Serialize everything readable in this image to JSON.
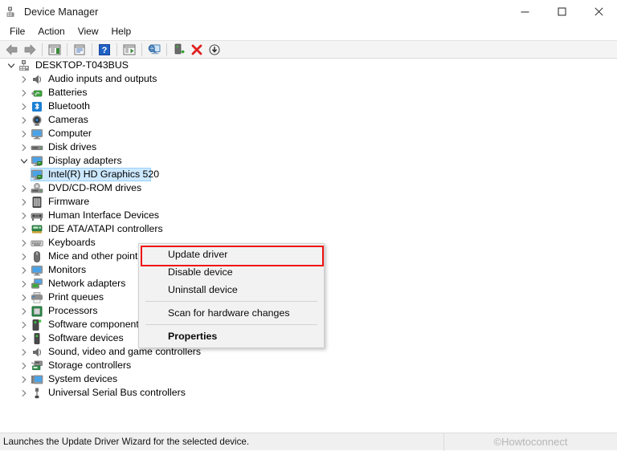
{
  "window": {
    "title": "Device Manager",
    "icon": "device-manager-icon",
    "controls": {
      "minimize": "minimize-icon",
      "maximize": "maximize-icon",
      "close": "close-icon"
    }
  },
  "menubar": {
    "items": [
      {
        "label": "File"
      },
      {
        "label": "Action"
      },
      {
        "label": "View"
      },
      {
        "label": "Help"
      }
    ]
  },
  "toolbar": {
    "buttons": [
      {
        "name": "back-icon",
        "type": "arrow-left"
      },
      {
        "name": "forward-icon",
        "type": "arrow-right"
      },
      {
        "name": "separator-1",
        "type": "separator"
      },
      {
        "name": "show-hide-console-tree-icon",
        "type": "window-tree"
      },
      {
        "name": "separator-2",
        "type": "separator"
      },
      {
        "name": "properties-icon",
        "type": "window-props"
      },
      {
        "name": "separator-3",
        "type": "separator"
      },
      {
        "name": "help-icon",
        "type": "help"
      },
      {
        "name": "separator-4",
        "type": "separator"
      },
      {
        "name": "action-icon",
        "type": "window-play"
      },
      {
        "name": "separator-5",
        "type": "separator"
      },
      {
        "name": "scan-for-hardware-changes-icon",
        "type": "monitor-scan"
      },
      {
        "name": "separator-6",
        "type": "separator"
      },
      {
        "name": "update-driver-icon",
        "type": "device-update"
      },
      {
        "name": "uninstall-device-icon",
        "type": "red-x"
      },
      {
        "name": "disable-device-icon",
        "type": "down-arrow-circle"
      }
    ]
  },
  "tree": {
    "root": {
      "label": "DESKTOP-T043BUS",
      "icon": "computer-root-icon",
      "expanded": true,
      "level": 0
    },
    "items": [
      {
        "label": "Audio inputs and outputs",
        "icon": "speaker-icon",
        "expanded": false,
        "level": 1
      },
      {
        "label": "Batteries",
        "icon": "battery-icon",
        "expanded": false,
        "level": 1
      },
      {
        "label": "Bluetooth",
        "icon": "bluetooth-icon",
        "expanded": false,
        "level": 1
      },
      {
        "label": "Cameras",
        "icon": "camera-icon",
        "expanded": false,
        "level": 1
      },
      {
        "label": "Computer",
        "icon": "monitor-icon",
        "expanded": false,
        "level": 1
      },
      {
        "label": "Disk drives",
        "icon": "disk-drive-icon",
        "expanded": false,
        "level": 1
      },
      {
        "label": "Display adapters",
        "icon": "display-adapter-icon",
        "expanded": true,
        "level": 1
      },
      {
        "label": "Intel(R) HD Graphics 520",
        "icon": "display-adapter-icon",
        "expanded": null,
        "level": 2,
        "selected": true
      },
      {
        "label": "DVD/CD-ROM drives",
        "icon": "optical-drive-icon",
        "expanded": false,
        "level": 1
      },
      {
        "label": "Firmware",
        "icon": "firmware-icon",
        "expanded": false,
        "level": 1
      },
      {
        "label": "Human Interface Devices",
        "icon": "hid-icon",
        "expanded": false,
        "level": 1
      },
      {
        "label": "IDE ATA/ATAPI controllers",
        "icon": "ide-controller-icon",
        "expanded": false,
        "level": 1
      },
      {
        "label": "Keyboards",
        "icon": "keyboard-icon",
        "expanded": false,
        "level": 1
      },
      {
        "label": "Mice and other pointing devices",
        "icon": "mouse-icon",
        "expanded": false,
        "level": 1
      },
      {
        "label": "Monitors",
        "icon": "monitor-icon",
        "expanded": false,
        "level": 1
      },
      {
        "label": "Network adapters",
        "icon": "network-adapter-icon",
        "expanded": false,
        "level": 1
      },
      {
        "label": "Print queues",
        "icon": "printer-icon",
        "expanded": false,
        "level": 1
      },
      {
        "label": "Processors",
        "icon": "processor-icon",
        "expanded": false,
        "level": 1
      },
      {
        "label": "Software components",
        "icon": "software-component-icon",
        "expanded": false,
        "level": 1
      },
      {
        "label": "Software devices",
        "icon": "software-device-icon",
        "expanded": false,
        "level": 1
      },
      {
        "label": "Sound, video and game controllers",
        "icon": "speaker-icon",
        "expanded": false,
        "level": 1
      },
      {
        "label": "Storage controllers",
        "icon": "storage-controller-icon",
        "expanded": false,
        "level": 1
      },
      {
        "label": "System devices",
        "icon": "system-device-icon",
        "expanded": false,
        "level": 1
      },
      {
        "label": "Universal Serial Bus controllers",
        "icon": "usb-icon",
        "expanded": false,
        "level": 1
      }
    ]
  },
  "context_menu": {
    "highlighted_item": "Update driver",
    "highlight_color": "#ee1111",
    "items": [
      {
        "label": "Update driver",
        "bold": false,
        "separator_after": false
      },
      {
        "label": "Disable device",
        "bold": false,
        "separator_after": false
      },
      {
        "label": "Uninstall device",
        "bold": false,
        "separator_after": true
      },
      {
        "label": "Scan for hardware changes",
        "bold": false,
        "separator_after": true
      },
      {
        "label": "Properties",
        "bold": true,
        "separator_after": false
      }
    ]
  },
  "statusbar": {
    "message": "Launches the Update Driver Wizard for the selected device.",
    "watermark": "©Howtoconnect"
  }
}
